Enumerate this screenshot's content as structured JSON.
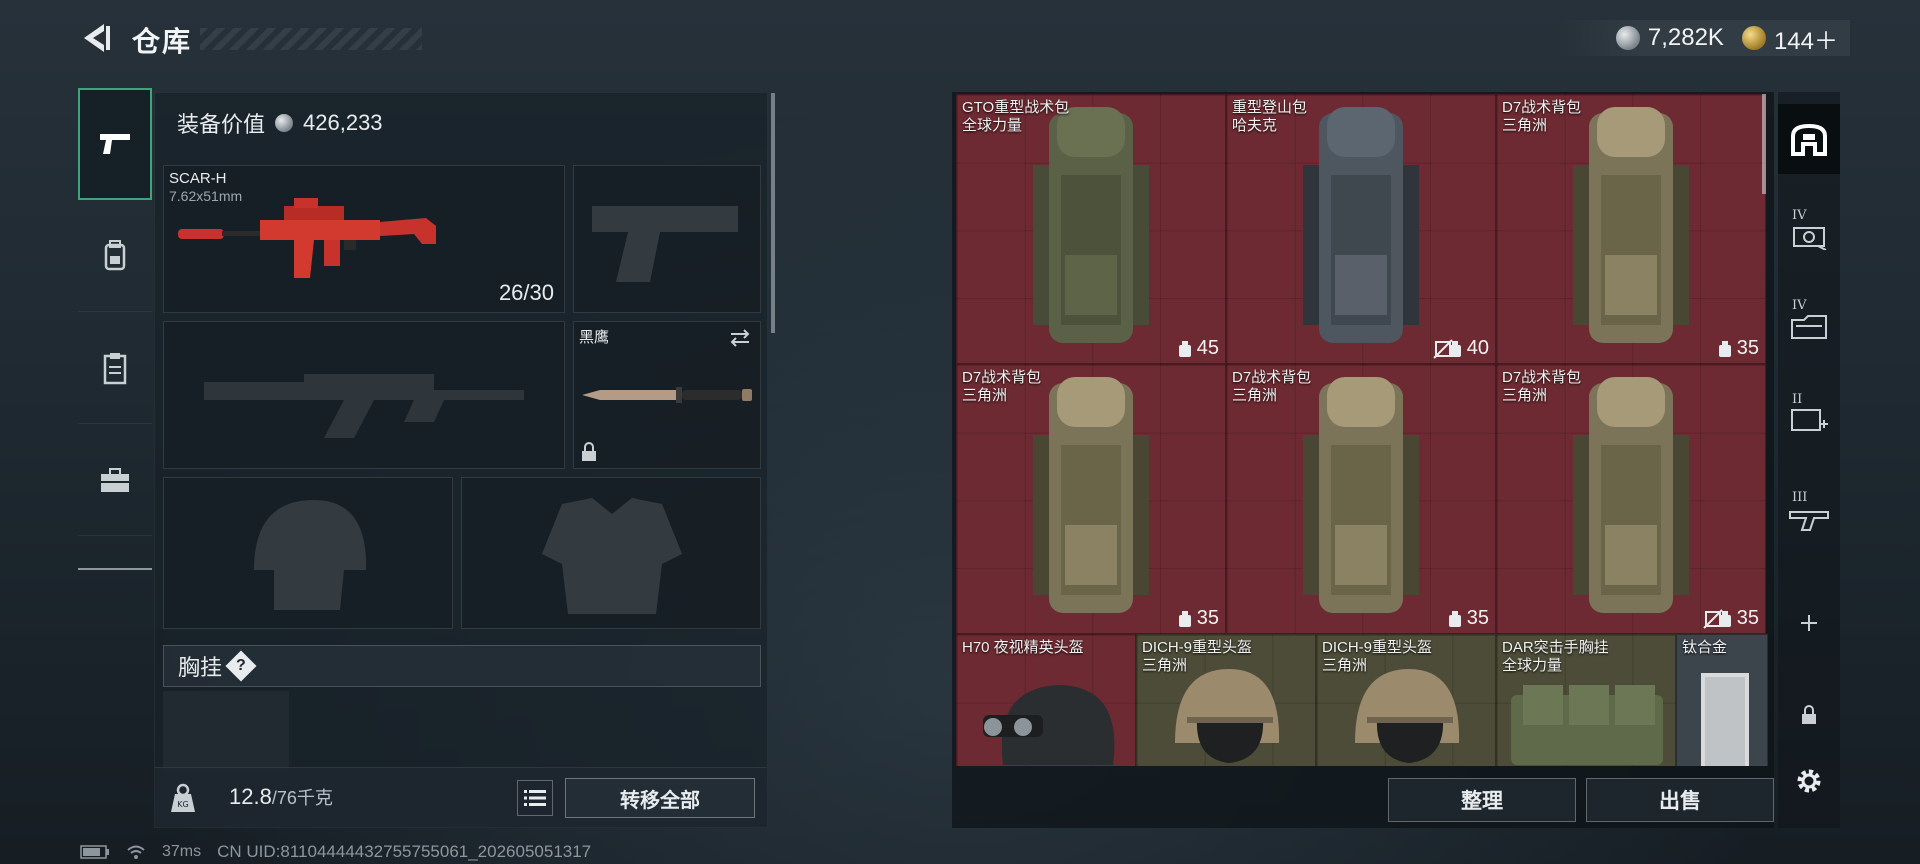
{
  "header": {
    "title": "仓库",
    "currencies": [
      {
        "icon": "silver-coin-icon",
        "value": "7,282K"
      },
      {
        "icon": "gold-coin-icon",
        "value": "144＋"
      }
    ]
  },
  "categories": [
    {
      "icon": "pistol-icon",
      "active": true
    },
    {
      "icon": "backpack-icon",
      "active": false
    },
    {
      "icon": "clipboard-icon",
      "active": false
    },
    {
      "icon": "toolbox-icon",
      "active": false
    }
  ],
  "loadout": {
    "value_label": "装备价值",
    "value": "426,233",
    "primary": {
      "name": "SCAR-H",
      "caliber": "7.62x51mm",
      "ammo": "26/30"
    },
    "melee": {
      "name": "黑鹰"
    },
    "section_label": "胸挂",
    "section_hint": "?",
    "weight_current": "12.8",
    "weight_max": "/76千克",
    "transfer_label": "转移全部"
  },
  "stash": {
    "items": [
      {
        "name": "GTO重型战术包",
        "sub": "全球力量",
        "cap": "45",
        "nosell": false
      },
      {
        "name": "重型登山包",
        "sub": "哈夫克",
        "cap": "40",
        "nosell": true
      },
      {
        "name": "D7战术背包",
        "sub": "三角洲",
        "cap": "35",
        "nosell": false
      },
      {
        "name": "D7战术背包",
        "sub": "三角洲",
        "cap": "35",
        "nosell": false
      },
      {
        "name": "D7战术背包",
        "sub": "三角洲",
        "cap": "35",
        "nosell": false
      },
      {
        "name": "D7战术背包",
        "sub": "三角洲",
        "cap": "35",
        "nosell": true
      },
      {
        "name": "H70 夜视精英头盔",
        "sub": ""
      },
      {
        "name": "DICH-9重型头盔",
        "sub": "三角洲"
      },
      {
        "name": "DICH-9重型头盔",
        "sub": "三角洲"
      },
      {
        "name": "DAR突击手胸挂",
        "sub": "全球力量"
      },
      {
        "name": "钛合金",
        "sub": ""
      }
    ],
    "sort_label": "整理",
    "sell_label": "出售"
  },
  "filters": [
    {
      "icon": "all-items-icon",
      "roman": ""
    },
    {
      "icon": "ammo-box-icon",
      "roman": "IV"
    },
    {
      "icon": "magazine-icon",
      "roman": "IV"
    },
    {
      "icon": "medkit-icon",
      "roman": "II"
    },
    {
      "icon": "rifle-part-icon",
      "roman": "III"
    },
    {
      "icon": "add-icon",
      "roman": ""
    },
    {
      "icon": "lock-icon",
      "roman": ""
    },
    {
      "icon": "gear-icon",
      "roman": ""
    }
  ],
  "status": {
    "ping": "37ms",
    "uid": "CN UID:81104444432755755061_202605051317"
  },
  "colors": {
    "accent": "#3ea57a",
    "cell_red": "#6e2a32",
    "scar_red": "#c8322c"
  }
}
